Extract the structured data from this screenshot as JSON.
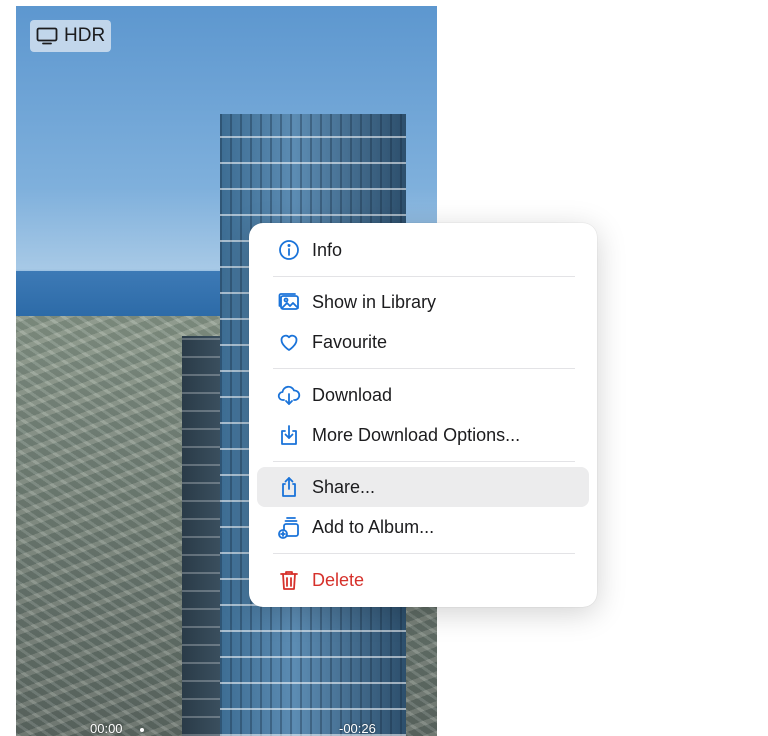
{
  "photo": {
    "badge_label": "HDR",
    "time_elapsed": "00:00",
    "time_remaining": "-00:26"
  },
  "menu": {
    "items": [
      {
        "label": "Info",
        "icon": "info-icon"
      },
      {
        "label": "Show in Library",
        "icon": "photo-library-icon"
      },
      {
        "label": "Favourite",
        "icon": "heart-icon"
      },
      {
        "label": "Download",
        "icon": "cloud-download-icon"
      },
      {
        "label": "More Download Options...",
        "icon": "download-tray-icon"
      },
      {
        "label": "Share...",
        "icon": "share-icon"
      },
      {
        "label": "Add to Album...",
        "icon": "add-to-album-icon"
      },
      {
        "label": "Delete",
        "icon": "trash-icon"
      }
    ],
    "highlighted_item": "Share...",
    "accent_color": "#1a73d9",
    "destructive_color": "#d6312b"
  }
}
